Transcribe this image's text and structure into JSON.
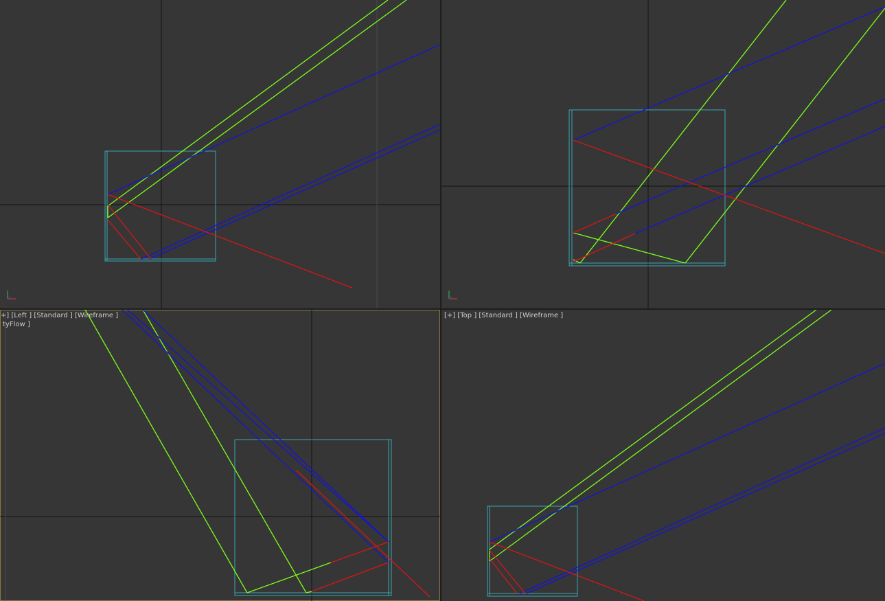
{
  "viewports": {
    "top_left": {
      "label": ""
    },
    "top_right": {
      "label": ""
    },
    "bottom_left": {
      "label": "[+] [Left ] [Standard ] [Wireframe ]",
      "sublabel": "tyFlow ]"
    },
    "bottom_right": {
      "label": "[+] [Top ] [Standard ] [Wireframe ]"
    }
  },
  "colors": {
    "viewport_bg": "#363636",
    "frame_bg": "#1e1e1e",
    "active_border": "#8c7a3c",
    "grid_axis": "#111111",
    "bbox": "#3aa7b4",
    "line_green": "#7dff1a",
    "line_blue": "#1515d6",
    "line_red": "#d81616"
  },
  "icons": {
    "axis_gizmo": "xyz-axis-tripod-icon"
  }
}
